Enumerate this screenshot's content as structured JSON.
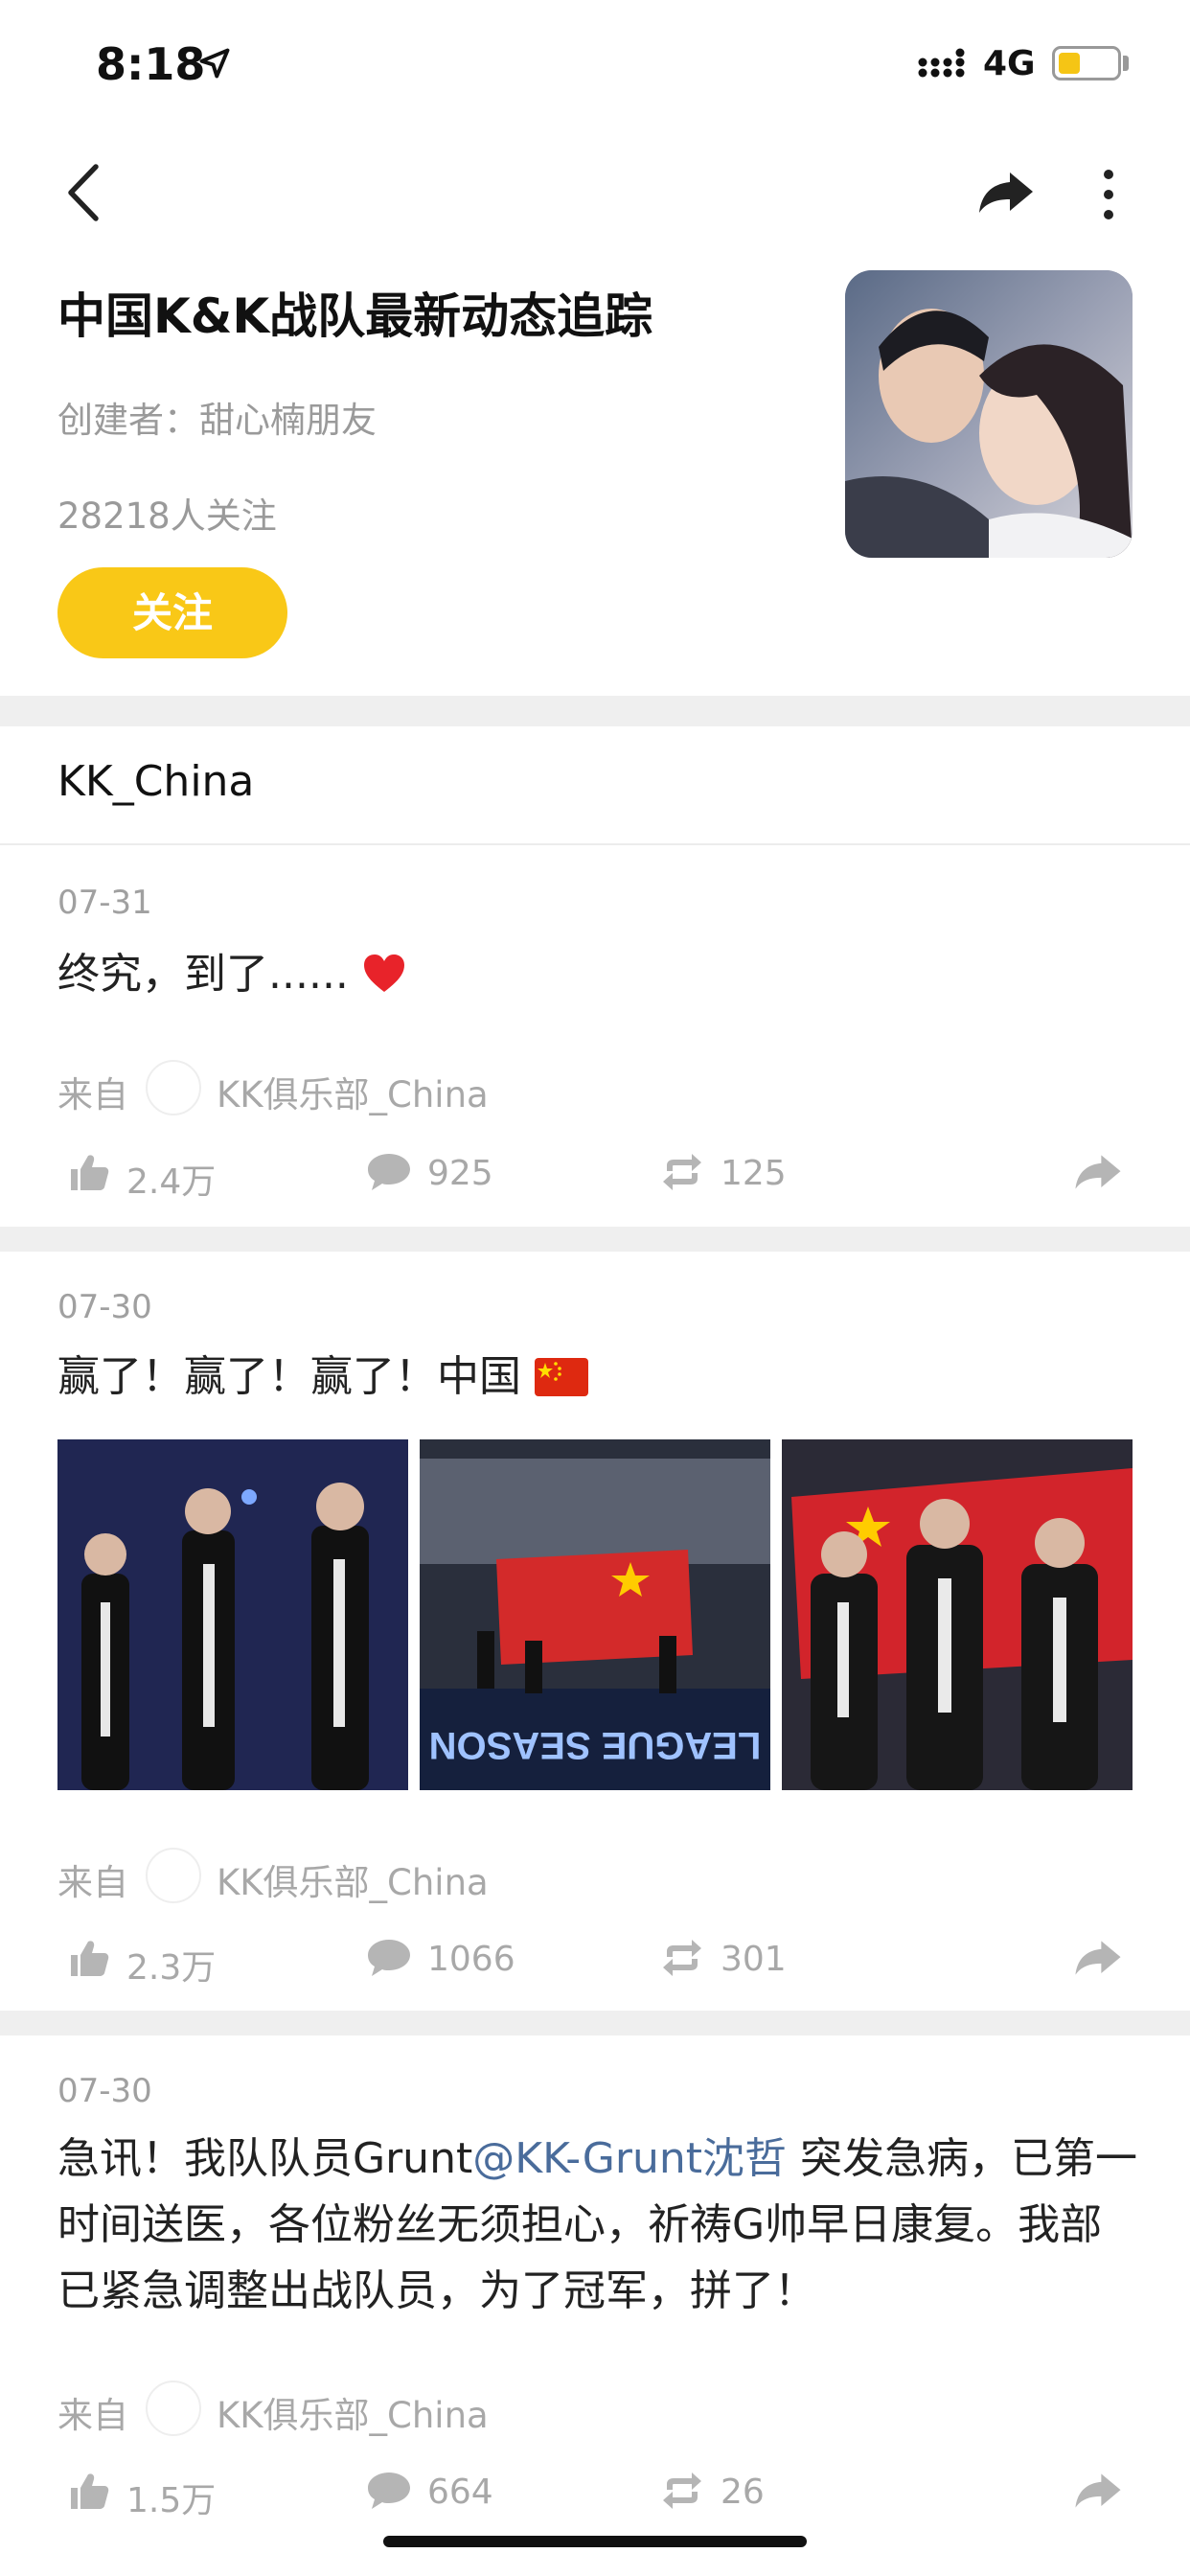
{
  "status_bar": {
    "time": "8:18",
    "network": "4G",
    "battery_color": "#f5c515"
  },
  "header": {
    "title": "中国K&K战队最新动态追踪",
    "creator": "创建者：甜心楠朋友",
    "followers": "28218人关注",
    "follow_label": "关注",
    "accent_color": "#f9c817"
  },
  "section_title": "KK_China",
  "posts": [
    {
      "date": "07-31",
      "text": "终究，到了......",
      "source_label": "来自",
      "source_name": "KK俱乐部_China",
      "likes": "2.4万",
      "comments": "925",
      "reposts": "125"
    },
    {
      "date": "07-30",
      "text": "赢了！赢了！赢了！中国",
      "source_label": "来自",
      "source_name": "KK俱乐部_China",
      "likes": "2.3万",
      "comments": "1066",
      "reposts": "301",
      "photo_text": "LEAGUE SEASON"
    },
    {
      "date": "07-30",
      "text_before": "急讯！我队队员Grunt",
      "mention": "@KK-Grunt沈哲",
      "text_after": " 突发急病，已第一时间送医，各位粉丝无须担心，祈祷G帅早日康复。我部已紧急调整出战队员，为了冠军，拼了！",
      "source_label": "来自",
      "source_name": "KK俱乐部_China",
      "likes": "1.5万",
      "comments": "664",
      "reposts": "26"
    }
  ]
}
